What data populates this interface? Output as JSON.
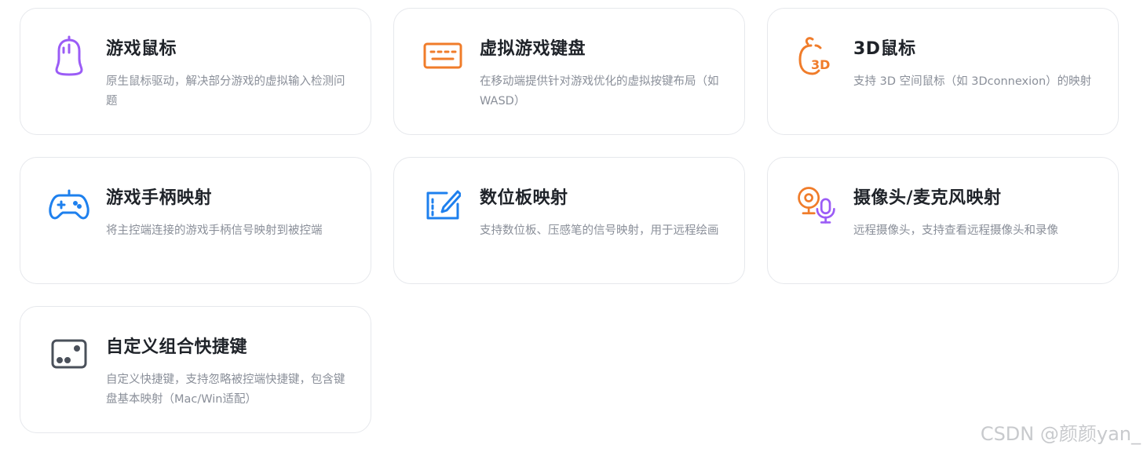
{
  "cards": [
    {
      "title": "游戏鼠标",
      "desc": "原生鼠标驱动，解决部分游戏的虚拟输入检测问题",
      "icon": "mouse-icon",
      "color": "#9b5cf6"
    },
    {
      "title": "虚拟游戏键盘",
      "desc": "在移动端提供针对游戏优化的虚拟按键布局（如WASD）",
      "icon": "keyboard-icon",
      "color": "#f07c2a"
    },
    {
      "title": "3D鼠标",
      "desc": "支持 3D 空间鼠标（如 3Dconnexion）的映射",
      "icon": "3d-mouse-icon",
      "color": "#f07c2a"
    },
    {
      "title": "游戏手柄映射",
      "desc": "将主控端连接的游戏手柄信号映射到被控端",
      "icon": "gamepad-icon",
      "color": "#1e80ee"
    },
    {
      "title": "数位板映射",
      "desc": "支持数位板、压感笔的信号映射，用于远程绘画",
      "icon": "tablet-pen-icon",
      "color": "#1e80ee"
    },
    {
      "title": "摄像头/麦克风映射",
      "desc": "远程摄像头，支持查看远程摄像头和录像",
      "icon": "camera-microphone-icon",
      "color": "#f07c2a",
      "color2": "#9b5cf6"
    },
    {
      "title": "自定义组合快捷键",
      "desc": "自定义快捷键，支持忽略被控端快捷键，包含键盘基本映射（Mac/Win适配）",
      "icon": "shortcut-keys-icon",
      "color": "#4a505a"
    }
  ],
  "watermark": "CSDN @颜颜yan_"
}
